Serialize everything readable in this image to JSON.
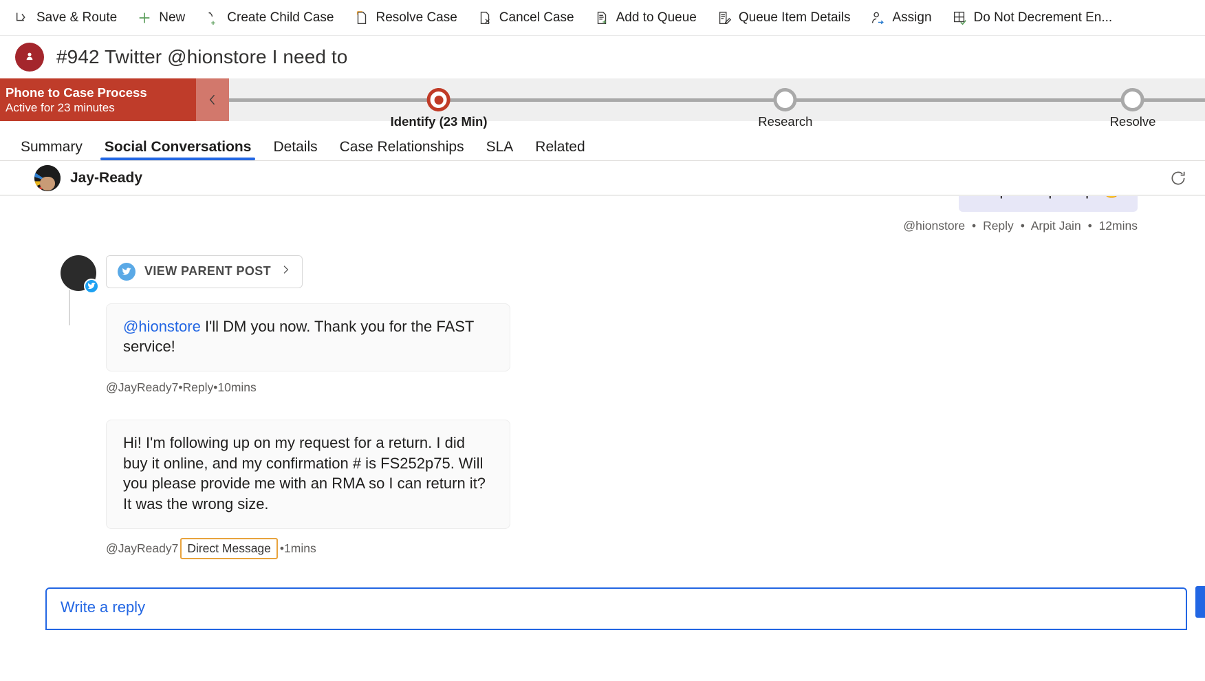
{
  "commandbar": {
    "items": [
      {
        "label": "Save & Route",
        "icon": "save-and-route-icon"
      },
      {
        "label": "New",
        "icon": "plus-icon"
      },
      {
        "label": "Create Child Case",
        "icon": "create-child-case-icon"
      },
      {
        "label": "Resolve Case",
        "icon": "resolve-case-icon"
      },
      {
        "label": "Cancel Case",
        "icon": "cancel-case-icon"
      },
      {
        "label": "Add to Queue",
        "icon": "add-to-queue-icon"
      },
      {
        "label": "Queue Item Details",
        "icon": "queue-item-details-icon"
      },
      {
        "label": "Assign",
        "icon": "assign-icon"
      },
      {
        "label": "Do Not Decrement En...",
        "icon": "do-not-decrement-icon"
      }
    ]
  },
  "header": {
    "title": "#942 Twitter @hionstore I need to",
    "avatar_icon": "case-person-icon",
    "avatar_color": "#a4262c"
  },
  "process": {
    "name": "Phone to Case Process",
    "status": "Active for 23 minutes",
    "collapse_icon": "chevron-left-icon",
    "header_color": "#bf3c2a",
    "stages": [
      {
        "label": "Identify  (23 Min)",
        "state": "active",
        "position_pct": 21.5
      },
      {
        "label": "Research",
        "state": "inactive",
        "position_pct": 57.0
      },
      {
        "label": "Resolve",
        "state": "inactive",
        "position_pct": 92.6
      }
    ]
  },
  "tabs": {
    "items": [
      {
        "label": "Summary",
        "selected": false
      },
      {
        "label": "Social Conversations",
        "selected": true
      },
      {
        "label": "Details",
        "selected": false
      },
      {
        "label": "Case Relationships",
        "selected": false
      },
      {
        "label": "SLA",
        "selected": false
      },
      {
        "label": "Related",
        "selected": false
      }
    ],
    "accent_color": "#2266e3"
  },
  "conversation": {
    "title": "Jay-Ready",
    "refresh_icon": "refresh-icon",
    "outgoing": {
      "text": "wrap this up asap.  🤩",
      "handle": "@hionstore",
      "action": "Reply",
      "author": "Arpit Jain",
      "time": "12mins"
    },
    "parent_post_button": {
      "label": "VIEW PARENT POST",
      "icon": "twitter-icon",
      "chevron": "chevron-right-icon"
    },
    "incoming": [
      {
        "mention": "@hionstore",
        "text": " I'll DM you now.  Thank you for the FAST service!",
        "handle": "@JayReady7",
        "action": "Reply",
        "time": "10mins",
        "badge": null
      },
      {
        "mention": "",
        "text": "Hi!  I'm following up on my request for a return.  I did buy it online, and my confirmation # is FS252p75.  Will you please provide me with an RMA so I can return it?  It was the wrong size.",
        "handle": "@JayReady7",
        "action": null,
        "time": "1mins",
        "badge": "Direct Message"
      }
    ],
    "reply_placeholder": "Write a reply"
  }
}
